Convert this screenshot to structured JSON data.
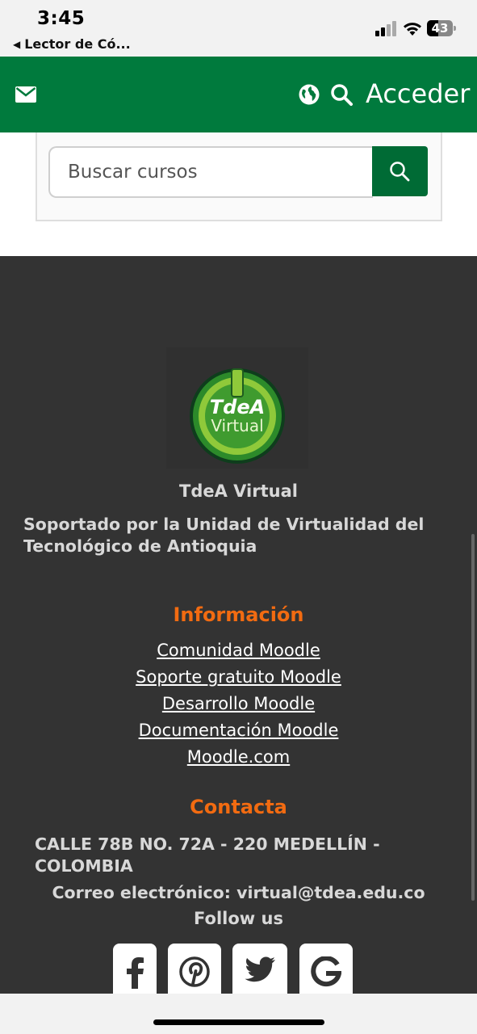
{
  "status_bar": {
    "time": "3:45",
    "back_app": "Lector de Có...",
    "battery": "43"
  },
  "navbar": {
    "login_label": "Acceder"
  },
  "search": {
    "placeholder": "Buscar cursos"
  },
  "footer": {
    "logo_text_top": "TdeA",
    "logo_text_bottom": "Virtual",
    "site_name": "TdeA Virtual",
    "site_description": "Soportado por la Unidad de Virtualidad del Tecnológico de Antioquia",
    "info_title": "Información",
    "info_links": [
      "Comunidad Moodle",
      "Soporte gratuito Moodle",
      "Desarrollo Moodle",
      "Documentación Moodle",
      "Moodle.com"
    ],
    "contact_title": "Contacta",
    "address": "CALLE 78B NO. 72A - 220 MEDELLÍN - COLOMBIA",
    "email_line": "Correo electrónico: virtual@tdea.edu.co",
    "follow_label": "Follow us",
    "social_icons": [
      "facebook-icon",
      "pinterest-icon",
      "twitter-icon",
      "google-icon"
    ]
  },
  "colors": {
    "brand_green": "#007a3d",
    "accent_orange": "#f26b11",
    "footer_bg": "#333333"
  }
}
